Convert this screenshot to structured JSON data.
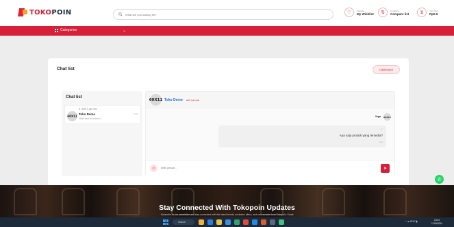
{
  "brand": {
    "part1": "TOKO",
    "part2": "POIN"
  },
  "search": {
    "placeholder": "What are you looking for?"
  },
  "header_links": {
    "wishlist": {
      "small": "Favorite",
      "big": "My Wishlist"
    },
    "compare": {
      "small": "Compare",
      "big": "Compare list"
    },
    "cart": {
      "small": "Your Cart",
      "big": "Rp0.0"
    }
  },
  "nav": {
    "categories": "Categories"
  },
  "page": {
    "title": "Chat list",
    "dashboard_button": "Dashboard"
  },
  "chat_list": {
    "title": "Chat list",
    "items": [
      {
        "online": "Aktif 1 jam lalu",
        "avatar": "60X11",
        "name": "Toko Demo",
        "time": "now",
        "preview": "Maaf, saat ini sedam k..."
      }
    ]
  },
  "chat": {
    "avatar": "60X11",
    "name": "Toko Demo",
    "status": "aktif 1 jam lalu",
    "message": {
      "sender": "Yoga",
      "sender_avatar": "60X11",
      "check": "✓",
      "text": "Apa saja produk yang tersedia?",
      "time": "now"
    },
    "input_placeholder": "ketik pesan..."
  },
  "banner": {
    "title": "Stay Connected With Tokopoin Updates",
    "subtitle": "Subscribe to our newsletter and stay connected with the latest trends, exclusive offers, and new arrivals from Tokopoin. Email"
  },
  "taskbar": {
    "search": "Search",
    "tray": "^  ☁  ENG  ▮",
    "time": "13:03",
    "date": "17/06/2024"
  },
  "colors": {
    "brand_red": "#d81f39",
    "accent_orange": "#f2a81d",
    "link_blue": "#1e6fd9",
    "whatsapp_green": "#25d366"
  }
}
